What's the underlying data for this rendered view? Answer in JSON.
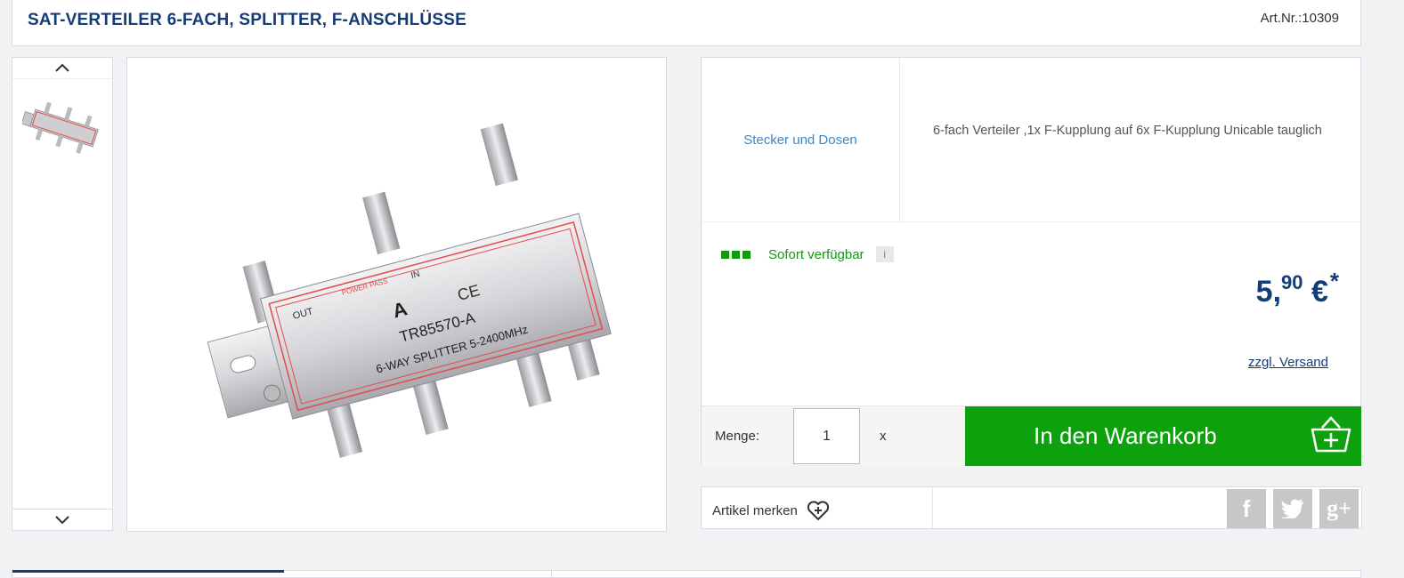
{
  "product": {
    "title": "SAT-VERTEILER 6-FACH, SPLITTER, F-ANSCHLÜSSE",
    "article_number": "Art.Nr.:10309",
    "category_link": "Stecker und Dosen",
    "description": "6-fach Verteiler ,1x F-Kupplung auf 6x F-Kupplung Unicable tauglich",
    "image_labels": {
      "model": "TR85570-A",
      "type": "6-WAY SPLITTER 5-2400MHz",
      "power_pass": "POWER PASS",
      "in": "IN",
      "out": "OUT",
      "ce": "CE",
      "brand_letter": "A"
    }
  },
  "availability": {
    "text": "Sofort verfügbar",
    "info_icon": "i",
    "level_filled": 3,
    "level_total": 3,
    "color": "#0f9a0f"
  },
  "price": {
    "main": "5,",
    "cents": "90",
    "currency": " €",
    "asterisk": "*",
    "shipping_link": "zzgl. Versand"
  },
  "cart": {
    "quantity_label": "Menge:",
    "quantity_value": "1",
    "times": "x",
    "button_label": "In den Warenkorb",
    "button_color": "#0ea10e"
  },
  "actions": {
    "wishlist_label": "Artikel merken",
    "social": [
      "facebook-icon",
      "twitter-icon",
      "google-plus-icon"
    ],
    "facebook_glyph": "f",
    "google_glyph": "g+"
  },
  "icons": {
    "up": "chevron-up-icon",
    "down": "chevron-down-icon"
  },
  "colors": {
    "brand_blue": "#163c78",
    "link_blue": "#3a87c7"
  }
}
